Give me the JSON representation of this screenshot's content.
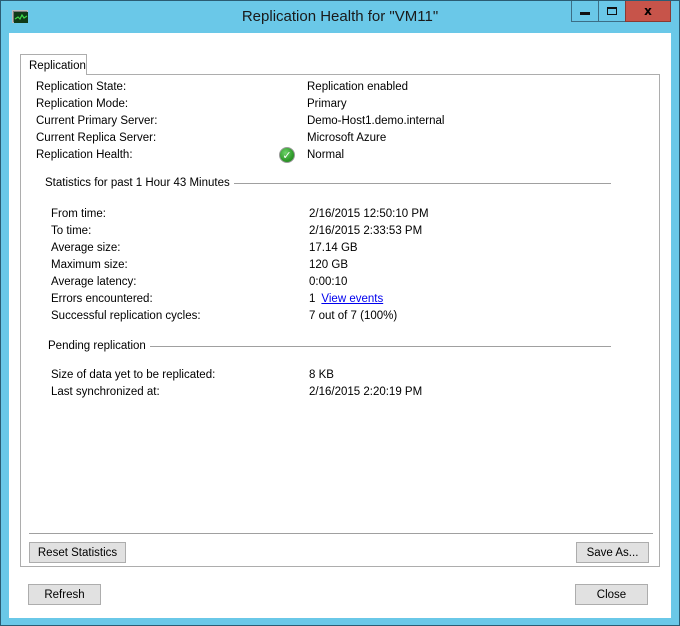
{
  "window": {
    "title": "Replication Health for \"VM11\"",
    "icon": "performance-monitor-icon",
    "controls": {
      "minimize": "minimize-icon",
      "maximize": "maximize-icon",
      "close": "close-icon",
      "close_glyph": "x"
    }
  },
  "tabs": [
    {
      "label": "Replication",
      "selected": true
    }
  ],
  "summary": [
    {
      "label": "Replication State:",
      "value": "Replication enabled"
    },
    {
      "label": "Replication Mode:",
      "value": "Primary"
    },
    {
      "label": "Current Primary Server:",
      "value": "Demo-Host1.demo.internal"
    },
    {
      "label": "Current Replica Server:",
      "value": "Microsoft Azure"
    },
    {
      "label": "Replication Health:",
      "value": "Normal",
      "icon": "check-circle-icon",
      "icon_glyph": "✓",
      "status_color": "#2f9a2a"
    }
  ],
  "statistics": {
    "title": "Statistics for past 1 Hour 43 Minutes",
    "rows": [
      {
        "label": "From time:",
        "value": "2/16/2015 12:50:10 PM"
      },
      {
        "label": "To time:",
        "value": "2/16/2015 2:33:53 PM"
      },
      {
        "label": "Average size:",
        "value": "17.14 GB"
      },
      {
        "label": "Maximum size:",
        "value": "120 GB"
      },
      {
        "label": "Average latency:",
        "value": "0:00:10"
      },
      {
        "label": "Errors encountered:",
        "value": "1",
        "link": "View events"
      },
      {
        "label": "Successful replication cycles:",
        "value": "7 out of 7 (100%)"
      }
    ]
  },
  "pending": {
    "title": "Pending replication",
    "rows": [
      {
        "label": "Size of data yet to be replicated:",
        "value": "8 KB"
      },
      {
        "label": "Last synchronized at:",
        "value": "2/16/2015 2:20:19 PM"
      }
    ]
  },
  "buttons": {
    "reset_statistics": "Reset Statistics",
    "save_as": "Save As...",
    "refresh": "Refresh",
    "close": "Close"
  },
  "colors": {
    "titlebar": "#6ac8e8",
    "close_button": "#c7544a",
    "link": "#0000ee"
  }
}
